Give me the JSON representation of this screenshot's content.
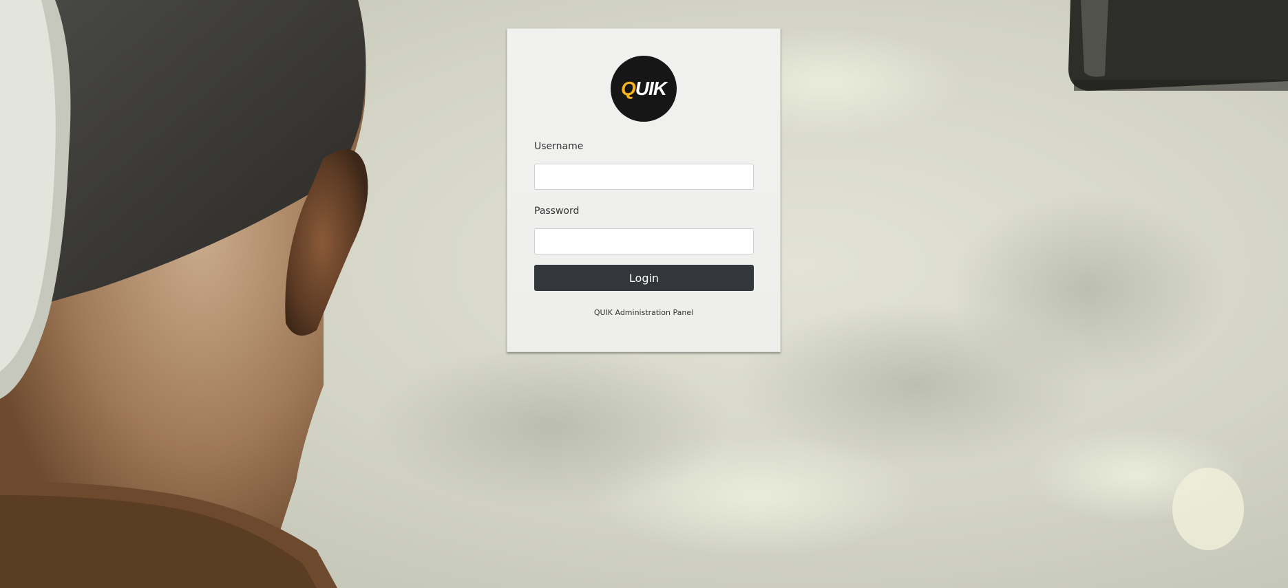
{
  "logo": {
    "text_q": "Q",
    "text_rest": "UIK",
    "accent_color": "#f5b21a",
    "background_color": "#161616"
  },
  "form": {
    "username_label": "Username",
    "username_value": "",
    "password_label": "Password",
    "password_value": "",
    "login_label": "Login"
  },
  "footer": {
    "text": "QUIK Administration Panel"
  },
  "colors": {
    "button": "#33363b",
    "card": "#f0f0ee"
  }
}
